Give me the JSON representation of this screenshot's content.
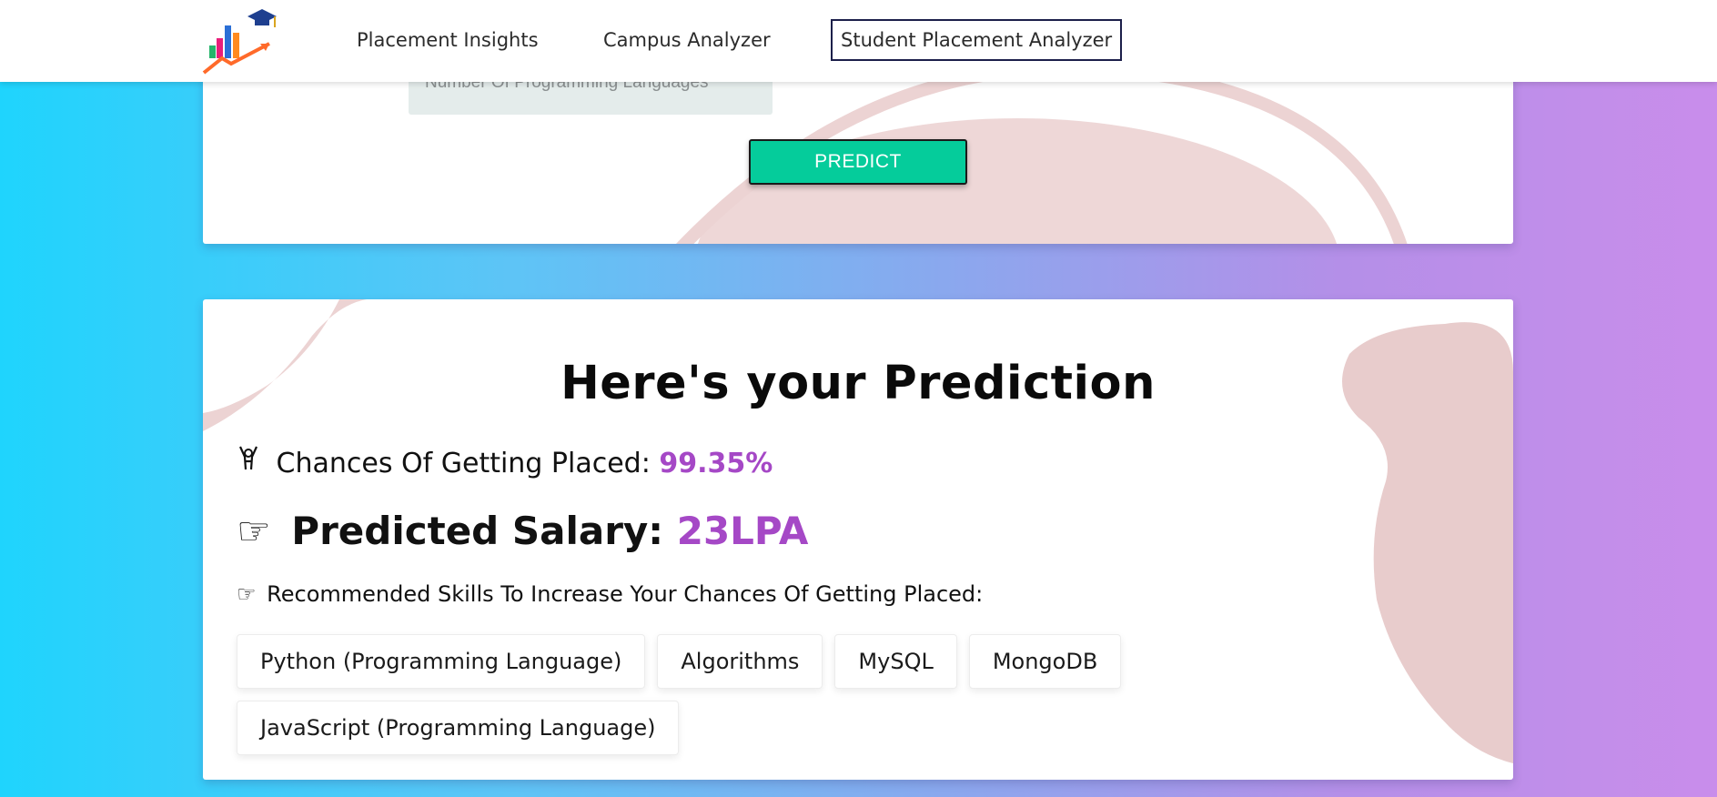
{
  "nav": {
    "links": [
      "Placement Insights",
      "Campus Analyzer",
      "Student Placement Analyzer"
    ]
  },
  "form": {
    "field_placeholder": "Number Of Programming Languages",
    "predict_label": "PREDICT"
  },
  "prediction": {
    "title": "Here's your Prediction",
    "chance_label": "Chances Of Getting Placed:",
    "chance_value": "99.35%",
    "salary_label": "Predicted Salary:",
    "salary_value": "23LPA",
    "skills_label": "Recommended Skills To Increase Your Chances Of Getting Placed:",
    "skills": [
      "Python (Programming Language)",
      "Algorithms",
      "MySQL",
      "MongoDB",
      "JavaScript (Programming Language)"
    ]
  },
  "icons": {
    "logo": "growth-chart-graduation-cap-logo",
    "chance": "celebrating-person-icon",
    "salary": "pointing-hand-icon",
    "skills": "pointing-hand-icon"
  },
  "colors": {
    "accent": "#a548c6",
    "predict_button": "#05cc9b",
    "decor_blob": "#ecd3d3",
    "active_nav_border": "#1c1f4a"
  }
}
